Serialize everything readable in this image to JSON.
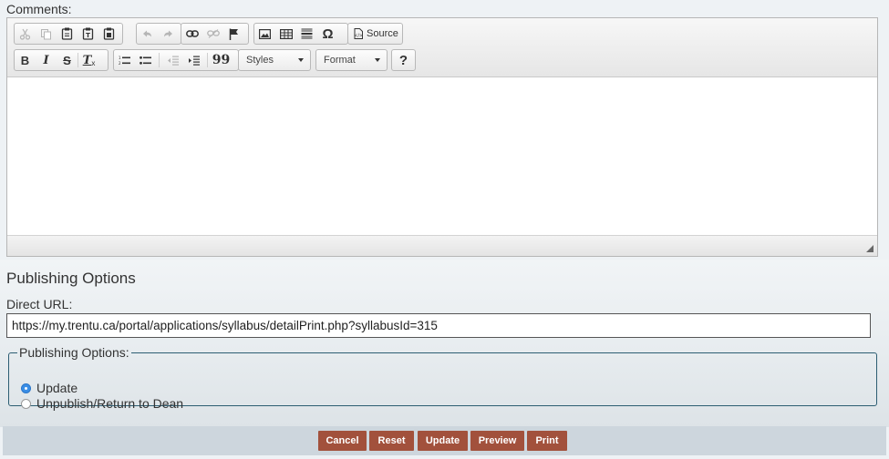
{
  "comments_label": "Comments:",
  "toolbar": {
    "row1": [
      {
        "icon": "cut-icon",
        "enabled": false
      },
      {
        "icon": "copy-icon",
        "enabled": false
      },
      {
        "icon": "paste-icon",
        "enabled": true
      },
      {
        "icon": "paste-text-icon",
        "enabled": true
      },
      {
        "icon": "paste-word-icon",
        "enabled": true
      },
      {
        "icon": "undo-icon",
        "enabled": false
      },
      {
        "icon": "redo-icon",
        "enabled": false
      },
      {
        "icon": "link-icon",
        "enabled": true
      },
      {
        "icon": "unlink-icon",
        "enabled": false
      },
      {
        "icon": "anchor-icon",
        "enabled": true
      },
      {
        "icon": "image-icon",
        "enabled": true
      },
      {
        "icon": "table-icon",
        "enabled": true
      },
      {
        "icon": "horizontal-rule-icon",
        "enabled": true
      },
      {
        "icon": "special-char-icon",
        "enabled": true
      }
    ],
    "source_label": "Source",
    "bold": "B",
    "italic": "I",
    "strike": "S",
    "remove_format": "T",
    "quote": "99",
    "styles_label": "Styles",
    "format_label": "Format",
    "help": "?",
    "omega": "Ω"
  },
  "publishing": {
    "heading": "Publishing Options",
    "url_label": "Direct URL:",
    "url_value": "https://my.trentu.ca/portal/applications/syllabus/detailPrint.php?syllabusId=315",
    "legend": "Publishing Options:",
    "options": [
      {
        "label": "Update",
        "selected": true
      },
      {
        "label": "Unpublish/Return to Dean",
        "selected": false
      }
    ]
  },
  "actions": [
    "Cancel",
    "Reset",
    "Update",
    "Preview",
    "Print"
  ],
  "colors": {
    "action_button": "#a2513c",
    "action_bar": "#cdd6dd",
    "radio_selected": "#3a8ee6",
    "fieldset_border": "#2c5d72"
  }
}
